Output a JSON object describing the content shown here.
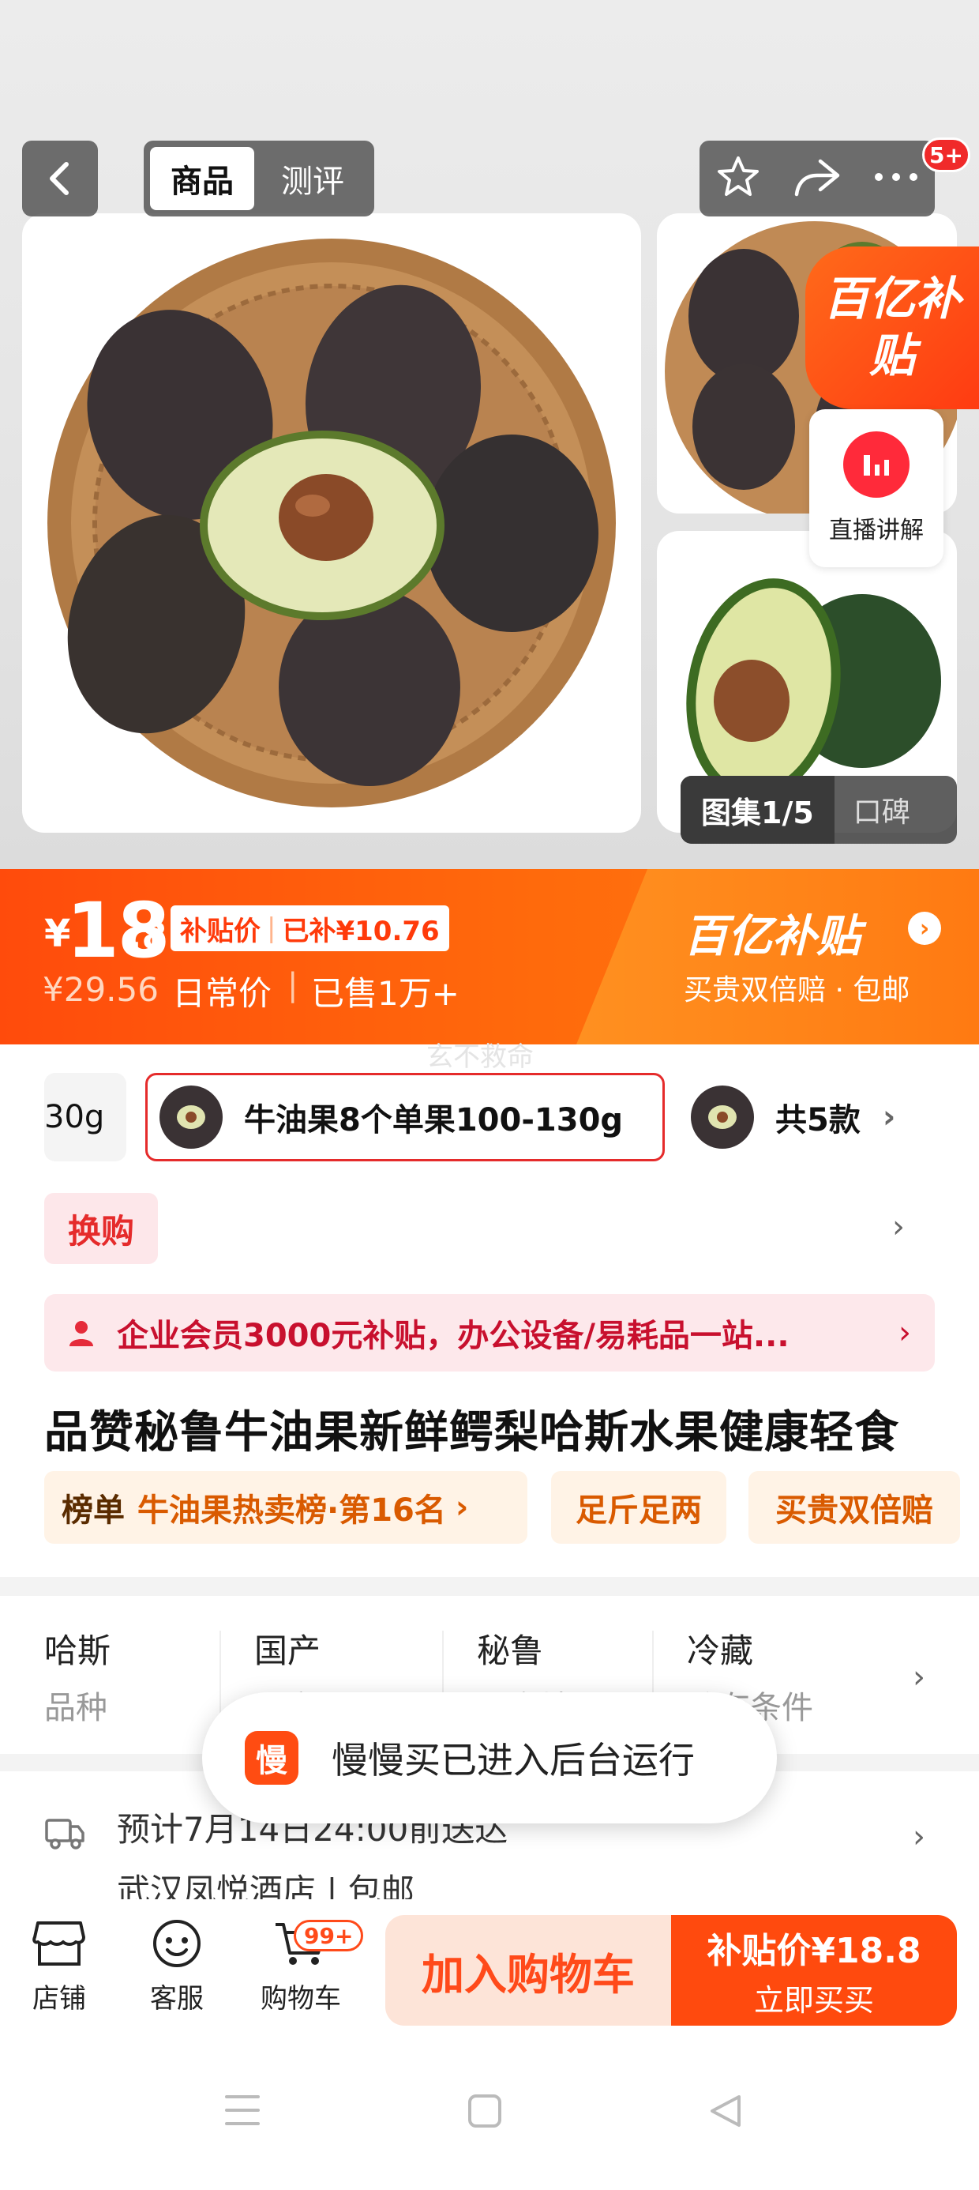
{
  "header": {
    "tabs": [
      {
        "label": "商品",
        "active": true
      },
      {
        "label": "测评",
        "active": false
      }
    ],
    "notification_badge": "5+"
  },
  "gallery": {
    "subsidy_tag": "百亿补贴",
    "live": {
      "label": "直播讲解"
    },
    "album": {
      "active": "图集1/5",
      "other": "口碑"
    }
  },
  "price": {
    "currency": "¥",
    "integer": "18",
    "decimal": ".8",
    "tag_label": "补贴价",
    "tag_subsidy": "已补¥10.76",
    "original": "¥29.56",
    "daily_label": "日常价",
    "separator": "|",
    "sold": "已售1万+",
    "brand_title": "百亿补贴",
    "brand_sub": "买贵双倍赔 · 包邮",
    "colors": {
      "accent": "#ff4b0c",
      "secondary": "#ff7a10"
    }
  },
  "watermark": "玄不救命",
  "sku": {
    "prev_fragment": "30g",
    "selected": "牛油果8个单果100-130g",
    "more": "共5款"
  },
  "exchange": {
    "label": "换购"
  },
  "enterprise": {
    "text": "企业会员3000元补贴，办公设备/易耗品一站..."
  },
  "product": {
    "title": "品赞秘鲁牛油果新鲜鳄梨哈斯水果健康轻食",
    "tags": {
      "rank_label": "榜单",
      "rank_value": "牛油果热卖榜·第16名",
      "weight": "足斤足两",
      "double": "买贵双倍赔"
    }
  },
  "specs": [
    {
      "value": "哈斯",
      "key": "品种"
    },
    {
      "value": "国产",
      "key": "国产/进口"
    },
    {
      "value": "秘鲁",
      "key": "原产地"
    },
    {
      "value": "冷藏",
      "key": "贮存条件"
    }
  ],
  "delivery": {
    "eta": "预计7月14日24:00前送达",
    "address": "武汉凤悦酒店 | 包邮"
  },
  "toast": {
    "icon_text": "慢",
    "text": "慢慢买已进入后台运行"
  },
  "bottom_bar": {
    "store": "店铺",
    "service": "客服",
    "cart": "购物车",
    "cart_badge": "99+",
    "add_to_cart": "加入购物车",
    "buy_price": "补贴价¥18.8",
    "buy_now": "立即买买"
  }
}
